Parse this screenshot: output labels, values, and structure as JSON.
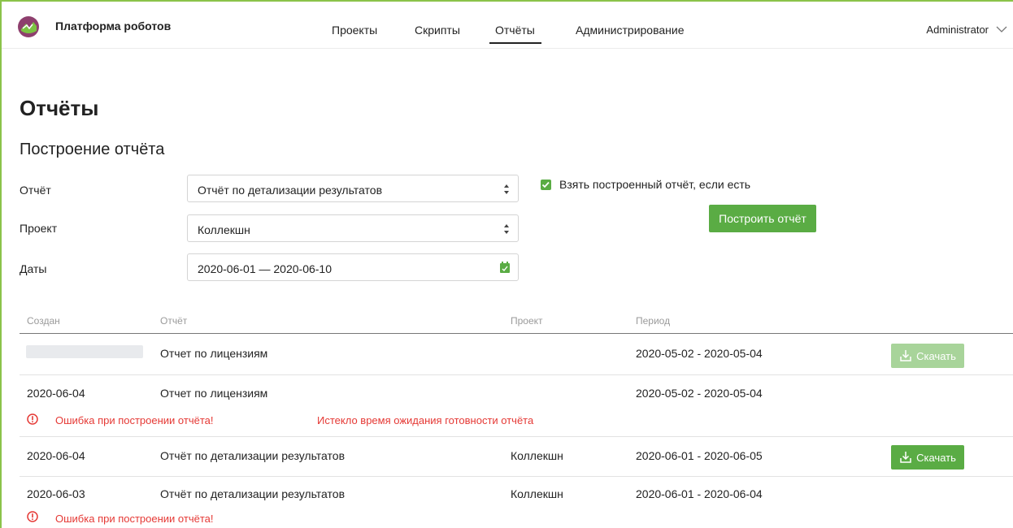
{
  "app": {
    "brand": "Платформа роботов",
    "user": "Administrator"
  },
  "nav": {
    "items": [
      {
        "label": "Проекты"
      },
      {
        "label": "Скрипты"
      },
      {
        "label": "Отчёты",
        "active": true
      },
      {
        "label": "Администрирование"
      }
    ]
  },
  "page": {
    "title": "Отчёты",
    "section_title": "Построение отчёта"
  },
  "form": {
    "report_label": "Отчёт",
    "report_value": "Отчёт по детализации результатов",
    "project_label": "Проект",
    "project_value": "Коллекшн",
    "dates_label": "Даты",
    "dates_value": "2020-06-01 — 2020-06-10",
    "use_existing_label": "Взять построенный отчёт, если есть",
    "use_existing_checked": true,
    "build_button": "Построить отчёт"
  },
  "table": {
    "columns": [
      "Создан",
      "Отчёт",
      "Проект",
      "Период"
    ],
    "rows": [
      {
        "created": "",
        "loading": true,
        "report": "Отчет по лицензиям",
        "project": "",
        "period": "2020-05-02 - 2020-05-04",
        "download": "Скачать",
        "download_enabled": false
      },
      {
        "created": "2020-06-04",
        "report": "Отчет по лицензиям",
        "project": "",
        "period": "2020-05-02 - 2020-05-04",
        "error": "Ошибка при построении отчёта!",
        "error_detail": "Истекло время ожидания готовности отчёта"
      },
      {
        "created": "2020-06-04",
        "report": "Отчёт по детализации результатов",
        "project": "Коллекшн",
        "period": "2020-06-01 - 2020-06-05",
        "download": "Скачать",
        "download_enabled": true
      },
      {
        "created": "2020-06-03",
        "report": "Отчёт по детализации результатов",
        "project": "Коллекшн",
        "period": "2020-06-01 - 2020-06-04",
        "error": "Ошибка при построении отчёта!"
      }
    ]
  },
  "colors": {
    "accent": "#5aac44",
    "accent_disabled": "#a8d49a",
    "error": "#e53935",
    "frame": "#8bc34a"
  },
  "icons": {
    "logo": "robot-platform-logo",
    "user_menu": "chevron-down-icon",
    "select_arrows": "sort-arrows-icon",
    "calendar": "calendar-check-icon",
    "download": "download-icon",
    "error": "exclamation-circle-icon"
  }
}
